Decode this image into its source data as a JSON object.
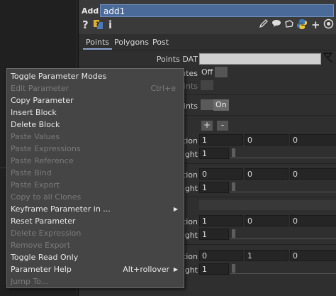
{
  "header": {
    "op_type": "Add",
    "op_name": "add1",
    "icons": [
      "help-icon",
      "python-help-icon",
      "info-icon",
      "edit-icon",
      "comment-icon",
      "clone-icon",
      "python-icon",
      "add-icon",
      "target-icon"
    ]
  },
  "tabs": [
    "Points",
    "Polygons",
    "Post"
  ],
  "params": {
    "points_dat_label": "Points DAT",
    "points_dat_value": "",
    "utes_label": "utes",
    "utes_value": "Off",
    "faded_label": "ints",
    "points_label": "ints",
    "points_value": "On",
    "rows": [
      {
        "label": "ition",
        "v1": "1",
        "v2": "0",
        "v3": "0"
      },
      {
        "label": "ight",
        "v1": "1"
      },
      {
        "label": "ition",
        "v1": "0",
        "v2": "0",
        "v3": "0"
      },
      {
        "label": "ight",
        "v1": "1"
      },
      {
        "label": "ition",
        "v1": "1",
        "v2": "0",
        "v3": "0"
      },
      {
        "label": "ight",
        "v1": "1"
      },
      {
        "label": "ition",
        "v1": "0",
        "v2": "1",
        "v3": "0"
      },
      {
        "label": "ight",
        "v1": "1"
      }
    ],
    "plus": "+",
    "minus": "-"
  },
  "menu": {
    "items": [
      {
        "label": "Toggle Parameter Modes",
        "enabled": true
      },
      {
        "label": "Edit Parameter",
        "shortcut": "Ctrl+e",
        "enabled": false
      },
      {
        "label": "Copy Parameter",
        "enabled": true
      },
      {
        "label": "Insert Block",
        "enabled": true
      },
      {
        "label": "Delete Block",
        "enabled": true
      },
      {
        "label": "Paste Values",
        "enabled": false
      },
      {
        "label": "Paste Expressions",
        "enabled": false
      },
      {
        "label": "Paste Reference",
        "enabled": false
      },
      {
        "label": "Paste Bind",
        "enabled": false
      },
      {
        "label": "Paste Export",
        "enabled": false
      },
      {
        "label": "Copy to all Clones",
        "enabled": false
      },
      {
        "label": "Keyframe Parameter in ...",
        "enabled": true,
        "submenu": true
      },
      {
        "label": "Reset Parameter",
        "enabled": true
      },
      {
        "label": "Delete Expression",
        "enabled": false
      },
      {
        "label": "Remove Export",
        "enabled": false
      },
      {
        "label": "Toggle Read Only",
        "enabled": true
      },
      {
        "label": "Parameter Help",
        "shortcut": "Alt+rollover",
        "enabled": true,
        "submenu": true
      },
      {
        "label": "Jump To...",
        "enabled": false
      }
    ]
  }
}
